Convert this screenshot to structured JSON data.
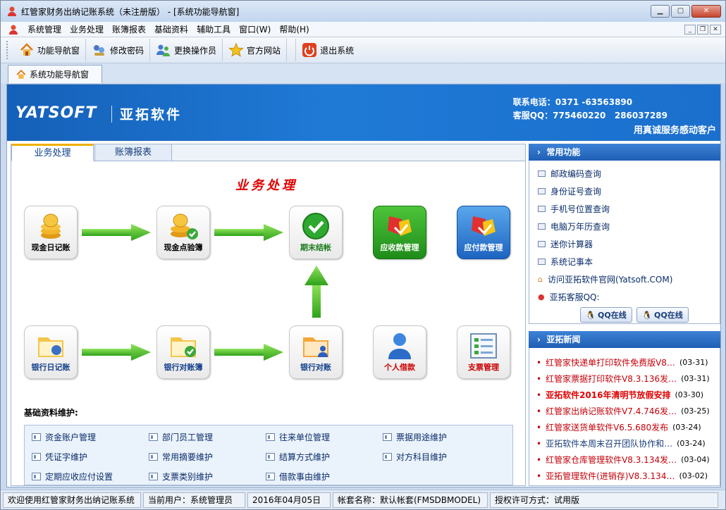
{
  "window": {
    "title": "红管家财务出纳记账系统（未注册版） - [系统功能导航窗]"
  },
  "menu": {
    "items": [
      "系统管理",
      "业务处理",
      "账簿报表",
      "基础资料",
      "辅助工具",
      "窗口(W)",
      "帮助(H)"
    ]
  },
  "toolbar": {
    "buttons": [
      "功能导航窗",
      "修改密码",
      "更换操作员",
      "官方网站",
      "退出系统"
    ]
  },
  "doc_tab": {
    "label": "系统功能导航窗"
  },
  "banner": {
    "logo": "YATSOFT",
    "company": "亚拓软件",
    "phone": "联系电话：0371 -63563890",
    "qq": "客服QQ：775460220   286037289",
    "slogan": "用真诚服务感动客户"
  },
  "left_tabs": [
    "业务处理",
    "账簿报表"
  ],
  "section_title": "业务处理",
  "flow_buttons": [
    "现金日记账",
    "现金点验簿",
    "期末结帐",
    "应收款管理",
    "应付款管理",
    "银行日记账",
    "银行对账簿",
    "银行对账",
    "个人借款",
    "支票管理"
  ],
  "base": {
    "title": "基础资料维护:",
    "items": [
      "资金账户管理",
      "部门员工管理",
      "往来单位管理",
      "票据用途维护",
      "凭证字维护",
      "常用摘要维护",
      "结算方式维护",
      "对方科目维护",
      "定期应收应付设置",
      "支票类别维护",
      "借款事由维护"
    ]
  },
  "common": {
    "title": "常用功能",
    "links": [
      "邮政编码查询",
      "身份证号查询",
      "手机号位置查询",
      "电脑万年历查询",
      "迷你计算器",
      "系统记事本",
      "访问亚拓软件官网(Yatsoft.COM)",
      "亚拓客服QQ:"
    ],
    "qq_buttons": [
      "QQ在线",
      "QQ在线"
    ]
  },
  "news": {
    "title": "亚拓新闻",
    "items": [
      {
        "text": "红管家快递单打印软件免费版V8…",
        "date": "(03-31)"
      },
      {
        "text": "红管家票据打印软件V8.3.136发…",
        "date": "(03-31)"
      },
      {
        "text": "亚拓软件2016年清明节放假安排",
        "date": "(03-30)",
        "bold": true
      },
      {
        "text": "红管家出纳记账软件V7.4.746发…",
        "date": "(03-25)"
      },
      {
        "text": "红管家送货单软件V6.5.680发布",
        "date": "(03-24)"
      },
      {
        "text": "亚拓软件本周末召开团队协作和…",
        "date": "(03-24)"
      },
      {
        "text": "红管家仓库管理软件V8.3.134发…",
        "date": "(03-04)"
      },
      {
        "text": "亚拓管理软件(进销存)V8.3.134…",
        "date": "(03-02)"
      }
    ]
  },
  "status": {
    "welcome": "欢迎使用红管家财务出纳记账系统",
    "user": "当前用户：系统管理员",
    "date": "2016年04月05日",
    "account": "帐套名称：默认帐套(FMSDBMODEL)",
    "license": "授权许可方式：试用版"
  }
}
